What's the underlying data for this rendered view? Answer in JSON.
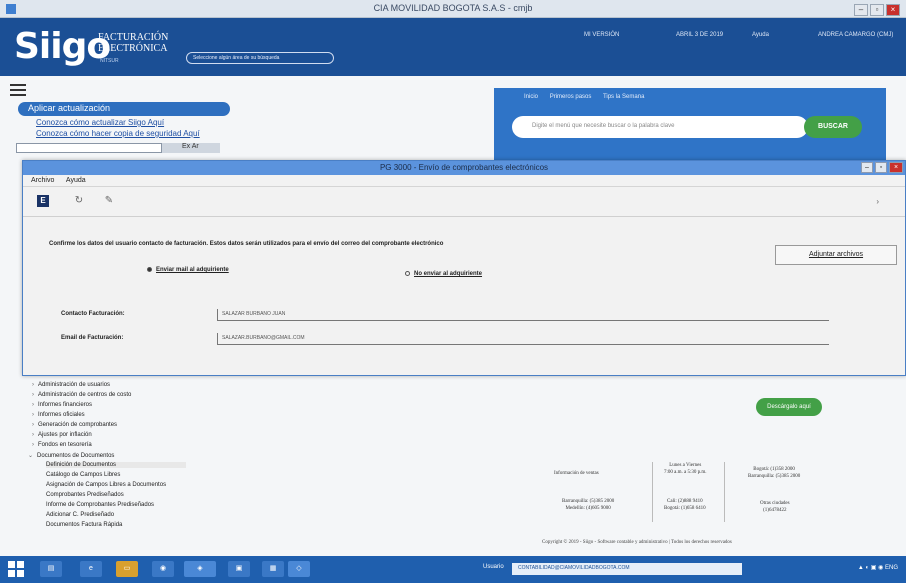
{
  "window": {
    "title": "CIA MOVILIDAD BOGOTA S.A.S - cmjb"
  },
  "header": {
    "logo": "Siigo",
    "logo_sub_1": "FACTURACIÓN",
    "logo_sub_2": "ELECTRÓNICA",
    "logo_tiny": "NITSUR",
    "search_pill": "Seleccione algún área de su búsqueda",
    "menu": [
      "MI VERSIÓN",
      "ABRIL 3 DE 2019",
      "Ayuda",
      "ANDREA CAMARGO (CMJ)"
    ]
  },
  "left": {
    "update_button": "Aplicar actualización",
    "links": [
      "Conozca cómo actualizar Siigo Aquí",
      "Conozca cómo hacer copia de seguridad Aquí"
    ],
    "field_ext": "Ex Ar"
  },
  "search_panel": {
    "tabs": [
      "Inicio",
      "Primeros pasos",
      "Tips la Semana"
    ],
    "placeholder": "Digite el menú que necesite buscar o la palabra clave",
    "button": "BUSCAR"
  },
  "dialog": {
    "title": "PG 3000 - Envío de comprobantes electrónicos",
    "menu": [
      "Archivo",
      "Ayuda"
    ],
    "instructions": "Confirme los datos del usuario contacto de facturación. Estos datos serán utilizados para el envío del correo del comprobante electrónico",
    "adjust_button": "Adjuntar archivos",
    "radio_send": "Enviar mail al adquiriente",
    "radio_nosend": "No enviar al adquiriente",
    "contact_label": "Contacto Facturación:",
    "contact_value": "SALAZAR BURBANO JUAN",
    "email_label": "Email de Facturación:",
    "email_value": "SALAZAR.BURBANO@GMAIL.COM"
  },
  "tree": {
    "items": [
      "Administración de usuarios",
      "Administración de centros de costo",
      "Informes financieros",
      "Informes oficiales",
      "Generación de comprobantes",
      "Ajustes por inflación",
      "Fondos en tesorería",
      "Documentos de Documentos"
    ],
    "subitems": [
      "Definición de Documentos",
      "Catálogo de Campos Libres",
      "Asignación de Campos Libres a Documentos",
      "Comprobantes Prediseñados",
      "Informe de Comprobantes Prediseñados",
      "Adicionar C. Prediseñado",
      "Documentos Factura Rápida"
    ]
  },
  "green_button": "Descárgalo aquí",
  "info": {
    "block1": [
      "Información de ventas"
    ],
    "block2": [
      "Lunes a Viernes",
      "7:00 a.m. a 5:30 p.m."
    ],
    "block3": [
      "Bogotá: (1)358 2000",
      "Barranquilla: (5)385 2000"
    ],
    "block4": [
      "Barranquilla: (5)385 2000",
      "Medellín: (4)605 9000"
    ],
    "block5": [
      "Cali: (2)888 9410",
      "Bogotá: (1)658 6410"
    ],
    "block6": [
      "Otras ciudades",
      "(1)6478422"
    ],
    "copyright": "Copyright © 2019 - Siigo - Software contable y administrativo | Todos los derechos reservados"
  },
  "taskbar": {
    "email_label": "Usuario",
    "email_value": "CONTABILIDAD@CIAMOVILIDADBOGOTA.COM"
  }
}
